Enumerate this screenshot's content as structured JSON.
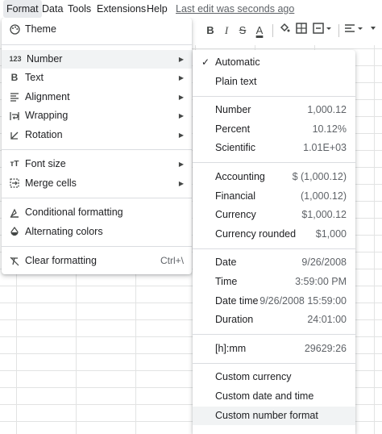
{
  "menubar": {
    "items": [
      "Format",
      "Data",
      "Tools",
      "Extensions",
      "Help"
    ],
    "last_edit": "Last edit was seconds ago"
  },
  "toolbar": {
    "bold": "B",
    "italic": "I",
    "strike": "S",
    "text_color": "A",
    "fill_icon": "fill-color-icon",
    "borders_icon": "borders-icon",
    "merge_icon": "merge-cells-icon",
    "align_icon": "align-icon",
    "more_icon": "more-icon"
  },
  "format_menu": {
    "items": [
      {
        "icon": "palette-icon",
        "label": "Theme"
      },
      {
        "icon": "number-icon",
        "label": "Number",
        "submenu": true
      },
      {
        "icon": "bold-icon",
        "label": "Text",
        "submenu": true
      },
      {
        "icon": "align-left-icon",
        "label": "Alignment",
        "submenu": true
      },
      {
        "icon": "wrap-icon",
        "label": "Wrapping",
        "submenu": true
      },
      {
        "icon": "rotation-icon",
        "label": "Rotation",
        "submenu": true
      },
      {
        "icon": "font-size-icon",
        "label": "Font size",
        "submenu": true
      },
      {
        "icon": "merge-icon",
        "label": "Merge cells",
        "submenu": true
      },
      {
        "icon": "conditional-icon",
        "label": "Conditional formatting"
      },
      {
        "icon": "droplet-icon",
        "label": "Alternating colors"
      },
      {
        "icon": "clear-format-icon",
        "label": "Clear formatting",
        "shortcut": "Ctrl+\\"
      }
    ],
    "number_icon_text": "123"
  },
  "number_menu": {
    "items": [
      {
        "label": "Automatic",
        "checked": true
      },
      {
        "label": "Plain text"
      },
      {
        "label": "Number",
        "value": "1,000.12"
      },
      {
        "label": "Percent",
        "value": "10.12%"
      },
      {
        "label": "Scientific",
        "value": "1.01E+03"
      },
      {
        "label": "Accounting",
        "value": "$ (1,000.12)"
      },
      {
        "label": "Financial",
        "value": "(1,000.12)"
      },
      {
        "label": "Currency",
        "value": "$1,000.12"
      },
      {
        "label": "Currency rounded",
        "value": "$1,000"
      },
      {
        "label": "Date",
        "value": "9/26/2008"
      },
      {
        "label": "Time",
        "value": "3:59:00 PM"
      },
      {
        "label": "Date time",
        "value": "9/26/2008 15:59:00"
      },
      {
        "label": "Duration",
        "value": "24:01:00"
      },
      {
        "label": "[h]:mm",
        "value": "29629:26"
      },
      {
        "label": "Custom currency"
      },
      {
        "label": "Custom date and time"
      },
      {
        "label": "Custom number format"
      }
    ]
  }
}
